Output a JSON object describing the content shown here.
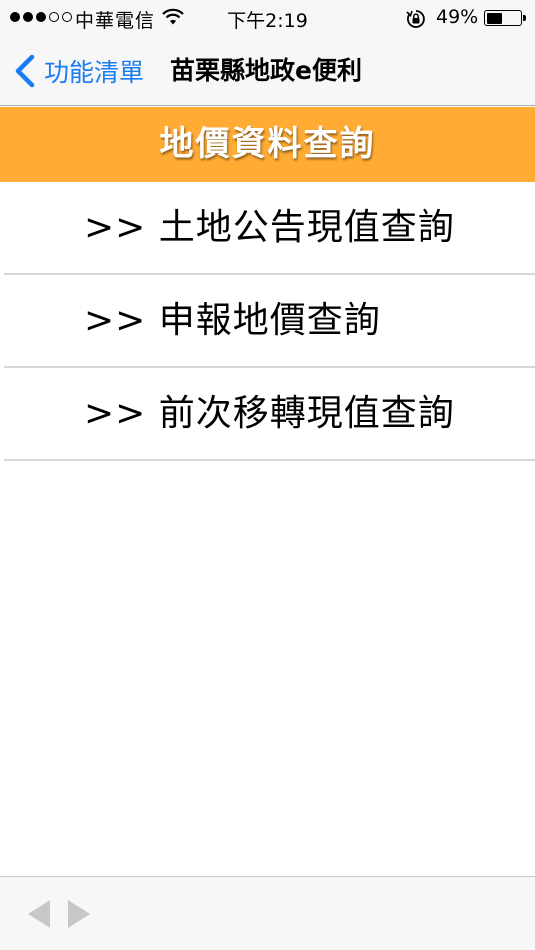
{
  "status_bar": {
    "carrier": "中華電信",
    "time": "下午2:19",
    "battery_percent": "49%",
    "battery_level": 0.49
  },
  "nav": {
    "back_label": "功能清單",
    "title": "苗栗縣地政e便利"
  },
  "section": {
    "title": "地價資料查詢"
  },
  "menu": {
    "items": [
      {
        "label": ">> 土地公告現值查詢"
      },
      {
        "label": ">> 申報地價查詢"
      },
      {
        "label": ">> 前次移轉現值查詢"
      }
    ]
  },
  "colors": {
    "accent_blue": "#1a7cf2",
    "header_orange": "#ffab34",
    "toolbar_disabled": "#c7c7c7"
  },
  "icons": {
    "back": "chevron-left-icon",
    "toolbar_back": "triangle-left-icon",
    "toolbar_forward": "triangle-right-icon"
  }
}
